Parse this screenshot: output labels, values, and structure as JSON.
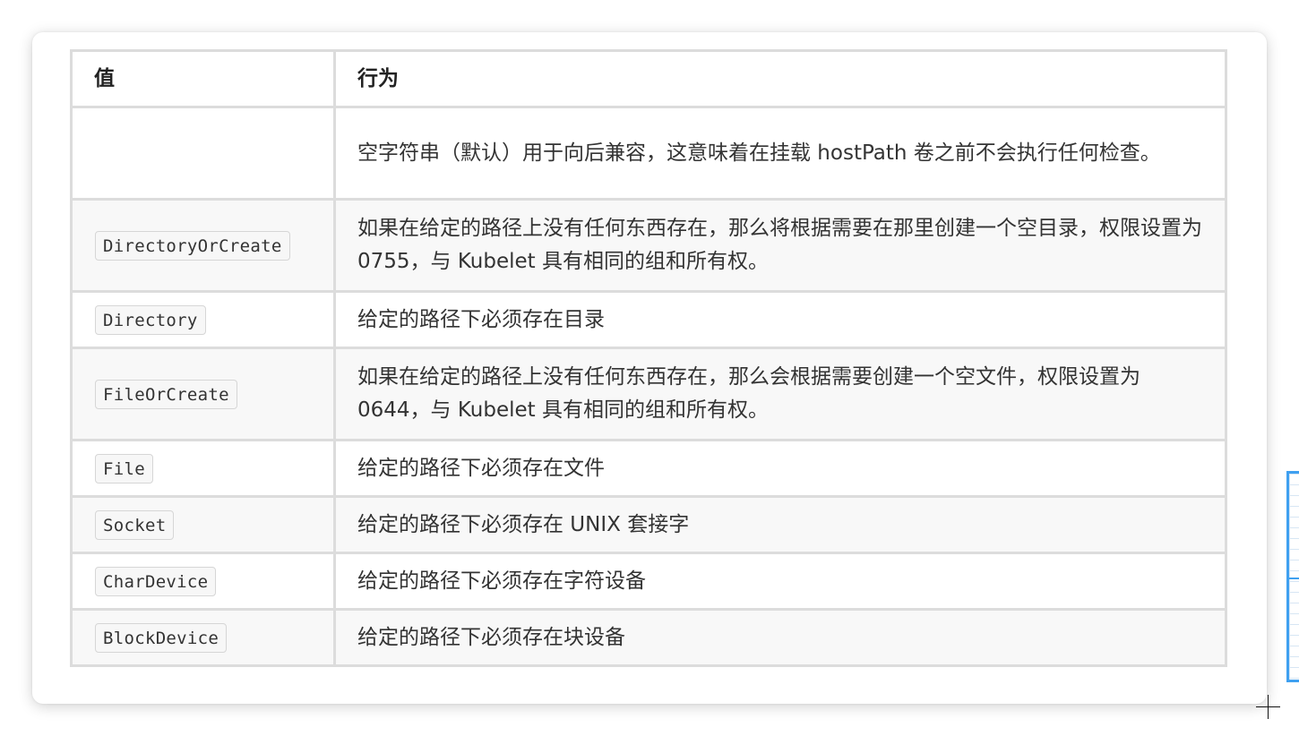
{
  "table": {
    "headers": {
      "value": "值",
      "behavior": "行为"
    },
    "rows": [
      {
        "value": "",
        "behavior": "空字符串（默认）用于向后兼容，这意味着在挂载 hostPath 卷之前不会执行任何检查。"
      },
      {
        "value": "DirectoryOrCreate",
        "behavior": "如果在给定的路径上没有任何东西存在，那么将根据需要在那里创建一个空目录，权限设置为 0755，与 Kubelet 具有相同的组和所有权。"
      },
      {
        "value": "Directory",
        "behavior": "给定的路径下必须存在目录"
      },
      {
        "value": "FileOrCreate",
        "behavior": "如果在给定的路径上没有任何东西存在，那么会根据需要创建一个空文件，权限设置为 0644，与 Kubelet 具有相同的组和所有权。"
      },
      {
        "value": "File",
        "behavior": "给定的路径下必须存在文件"
      },
      {
        "value": "Socket",
        "behavior": "给定的路径下必须存在 UNIX 套接字"
      },
      {
        "value": "CharDevice",
        "behavior": "给定的路径下必须存在字符设备"
      },
      {
        "value": "BlockDevice",
        "behavior": "给定的路径下必须存在块设备"
      }
    ]
  },
  "colors": {
    "border": "#dcdcdc",
    "stripe": "#f8f8f8",
    "code_background": "#f7f7f7",
    "text": "#333333",
    "side_frame_accent": "#3fa0f0"
  },
  "icons": {
    "cursor": "crosshair-cursor-icon"
  }
}
